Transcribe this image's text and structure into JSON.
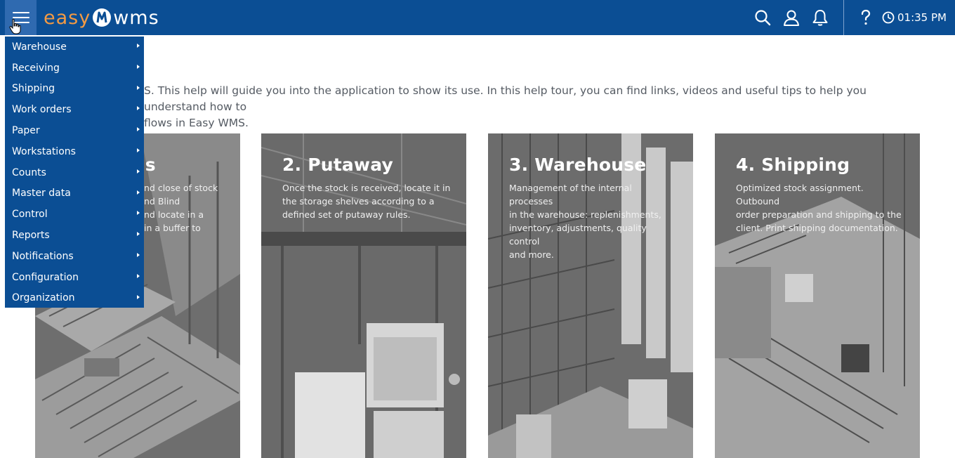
{
  "header": {
    "logo_left": "easy",
    "logo_right": "wms",
    "time": "01:35 PM",
    "colors": {
      "bar": "#0b4e94",
      "accent": "#f39a43"
    },
    "icons": [
      "menu-icon",
      "search-icon",
      "user-icon",
      "bell-icon",
      "help-icon",
      "clock-icon"
    ]
  },
  "intro": {
    "line1": "S. This help will guide you into the application to show its use. In this help tour, you can find links, videos and useful tips to help you understand how to",
    "line2": "flows in Easy WMS."
  },
  "cards": [
    {
      "title": "ls",
      "desc_lines": [
        "nd close of stock",
        "nd Blind",
        "nd locate in a",
        "in a buffer to"
      ]
    },
    {
      "title": "2. Putaway",
      "desc_lines": [
        "Once the stock is received, locate it in",
        "the storage shelves according to a",
        "defined set of putaway rules."
      ]
    },
    {
      "title": "3. Warehouse",
      "desc_lines": [
        "Management of the internal processes",
        "in the warehouse: replenishments,",
        "inventory, adjustments, quality control",
        "and more."
      ]
    },
    {
      "title": "4. Shipping",
      "desc_lines": [
        "Optimized stock assignment. Outbound",
        "order preparation and shipping to the",
        "client. Print shipping documentation."
      ]
    }
  ],
  "menu": {
    "items": [
      {
        "label": "Warehouse"
      },
      {
        "label": "Receiving"
      },
      {
        "label": "Shipping"
      },
      {
        "label": "Work orders"
      },
      {
        "label": "Paper"
      },
      {
        "label": "Workstations"
      },
      {
        "label": "Counts"
      },
      {
        "label": "Master data"
      },
      {
        "label": "Control"
      },
      {
        "label": "Reports"
      },
      {
        "label": "Notifications"
      },
      {
        "label": "Configuration"
      },
      {
        "label": "Organization"
      }
    ]
  }
}
